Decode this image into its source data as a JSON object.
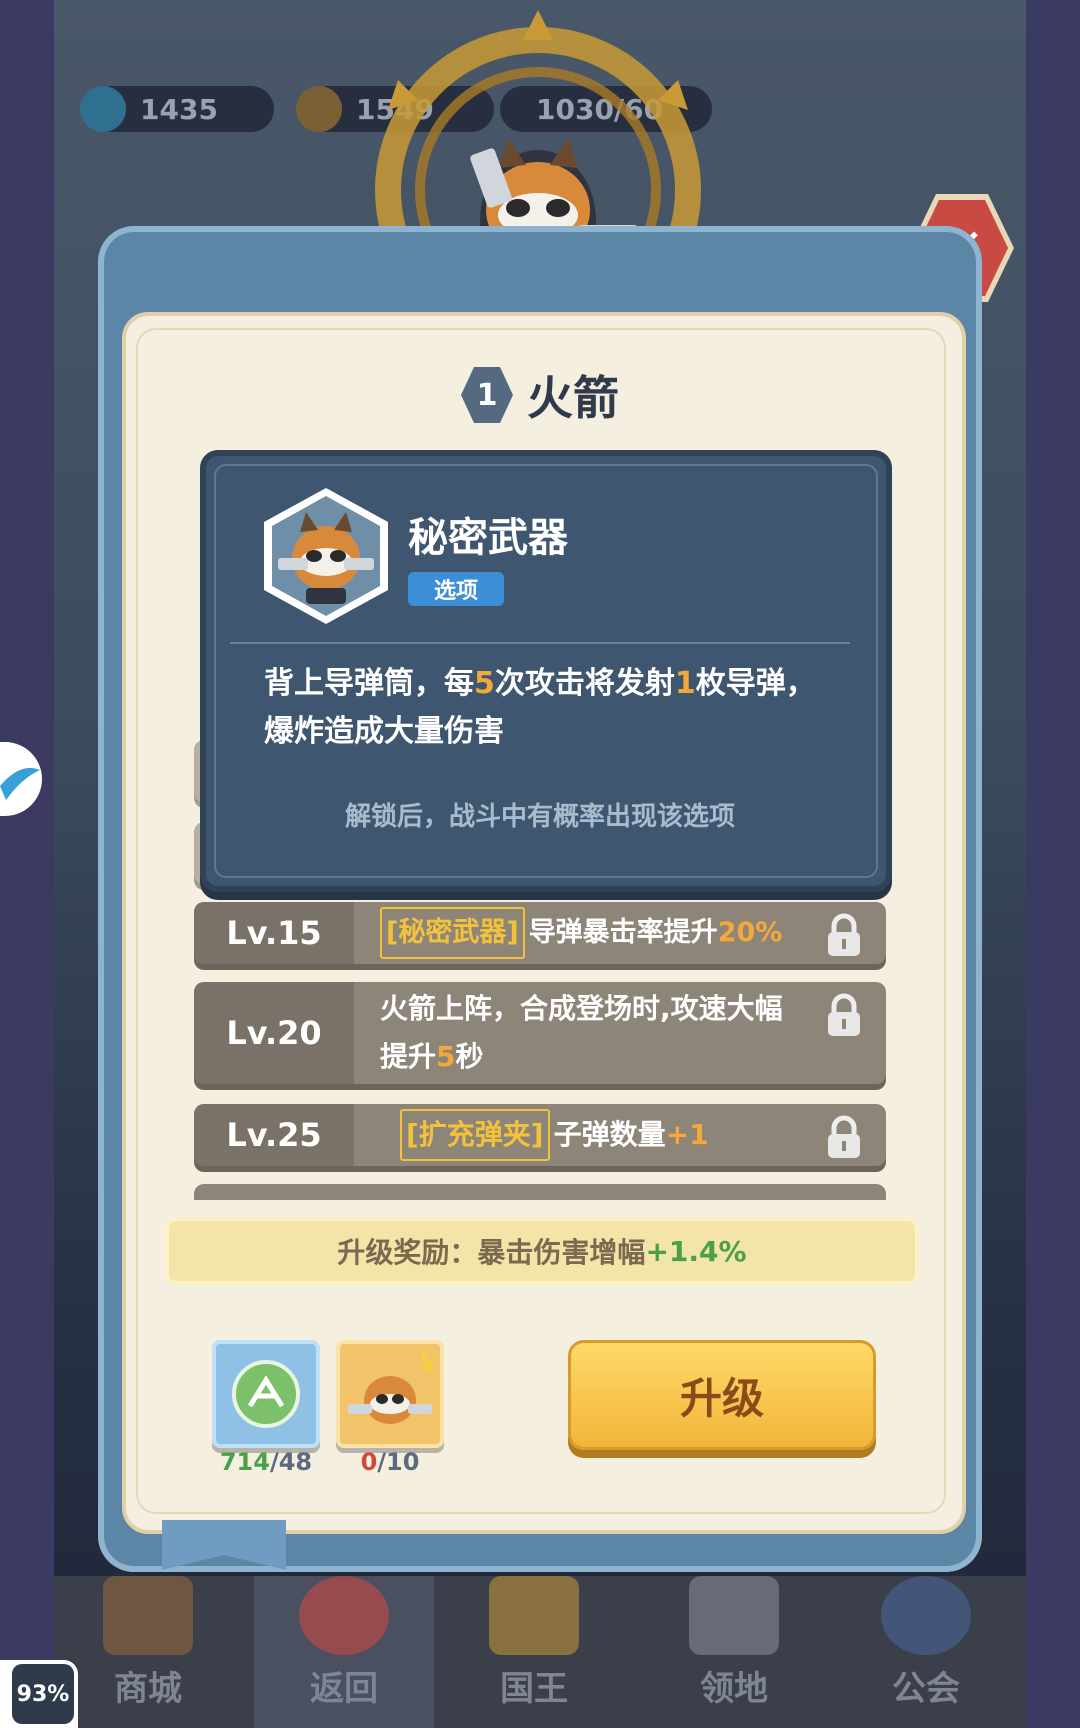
{
  "resources": {
    "gems": "1435",
    "coins": "1549",
    "stamina": "1030/60"
  },
  "hero": {
    "level_badge": "1",
    "name": "火箭"
  },
  "skill_tooltip": {
    "name": "秘密武器",
    "tag": "选项",
    "desc_part1": "背上导弹筒，每",
    "desc_hl1": "5",
    "desc_part2": "次攻击将发射",
    "desc_hl2": "1",
    "desc_part3": "枚导弹，爆炸造成大量伤害",
    "note": "解锁后，战斗中有概率出现该选项"
  },
  "upgrades": [
    {
      "level": "Lv.15",
      "tag": "[秘密武器]",
      "text": "导弹暴击率提升",
      "value": "20%"
    },
    {
      "level": "Lv.20",
      "text": "火箭上阵，合成登场时,攻速大幅提升",
      "value": "5",
      "suffix": "秒"
    },
    {
      "level": "Lv.25",
      "tag": "[扩充弹夹]",
      "text": " 子弹数量",
      "value": "+1"
    }
  ],
  "bonus": {
    "label": "升级奖励：暴击伤害增幅",
    "value": "+1.4%"
  },
  "materials": [
    {
      "icon": "exp-book-icon",
      "count_have": "714",
      "count_need": "/48",
      "have_color": "#4aa04a"
    },
    {
      "icon": "hero-shard-icon",
      "count_have": "0",
      "count_need": "/10",
      "have_color": "#d04a3a"
    }
  ],
  "upgrade_button": "升级",
  "tabs": [
    {
      "label": "商城",
      "icon": "shop-icon"
    },
    {
      "label": "返回",
      "icon": "back-icon"
    },
    {
      "label": "国王",
      "icon": "crown-icon"
    },
    {
      "label": "领地",
      "icon": "castle-icon"
    },
    {
      "label": "公会",
      "icon": "planet-icon"
    }
  ],
  "status": {
    "battery": "93%"
  }
}
